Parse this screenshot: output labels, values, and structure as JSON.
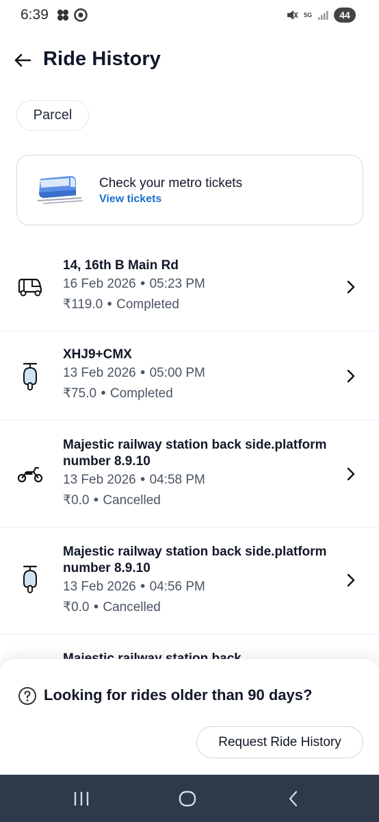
{
  "status_bar": {
    "time": "6:39",
    "network": "5G",
    "battery": "44"
  },
  "header": {
    "title": "Ride History"
  },
  "filter_chip": {
    "label": "Parcel"
  },
  "metro_card": {
    "title": "Check your metro tickets",
    "link": "View tickets"
  },
  "rides": [
    {
      "vehicle_icon": "auto-rickshaw-icon",
      "title": "14, 16th B Main Rd",
      "date": "16 Feb 2026",
      "time": "05:23 PM",
      "fare": "₹119.0",
      "status": "Completed"
    },
    {
      "vehicle_icon": "scooter-icon",
      "title": "XHJ9+CMX",
      "date": "13 Feb 2026",
      "time": "05:00 PM",
      "fare": "₹75.0",
      "status": "Completed"
    },
    {
      "vehicle_icon": "motorbike-icon",
      "title": "Majestic railway station back side.platform number 8.9.10",
      "date": "13 Feb 2026",
      "time": "04:58 PM",
      "fare": "₹0.0",
      "status": "Cancelled"
    },
    {
      "vehicle_icon": "scooter-icon",
      "title": "Majestic railway station back side.platform number 8.9.10",
      "date": "13 Feb 2026",
      "time": "04:56 PM",
      "fare": "₹0.0",
      "status": "Cancelled"
    },
    {
      "title": "Majestic railway station back"
    }
  ],
  "bottom_sheet": {
    "title": "Looking for rides older than 90 days?",
    "button": "Request Ride History"
  },
  "colors": {
    "accent_link": "#1d6fd1",
    "navbar": "#2e3a4a"
  }
}
